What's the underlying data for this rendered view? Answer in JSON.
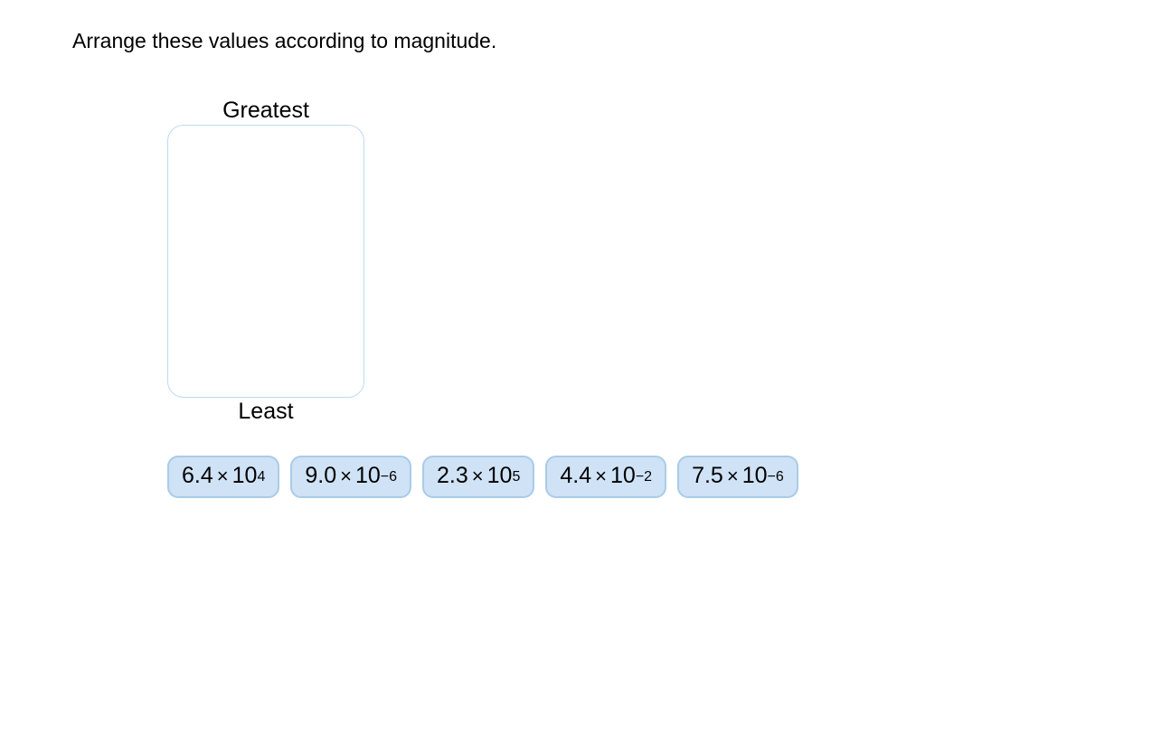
{
  "instruction": "Arrange these values according to magnitude.",
  "labels": {
    "top": "Greatest",
    "bottom": "Least"
  },
  "tiles": [
    {
      "coef": "6.4",
      "base": "10",
      "exp": "4"
    },
    {
      "coef": "9.0",
      "base": "10",
      "exp": "−6"
    },
    {
      "coef": "2.3",
      "base": "10",
      "exp": "5"
    },
    {
      "coef": "4.4",
      "base": "10",
      "exp": "−2"
    },
    {
      "coef": "7.5",
      "base": "10",
      "exp": "−6"
    }
  ],
  "symbols": {
    "times": "×"
  }
}
